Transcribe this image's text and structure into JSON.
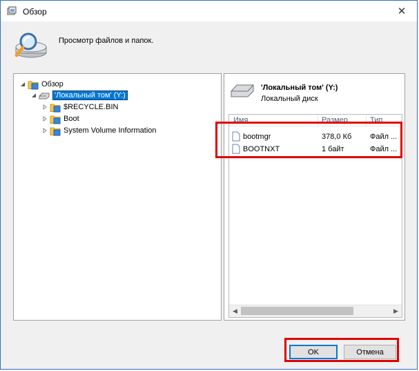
{
  "dialog": {
    "title": "Обзор",
    "description": "Просмотр файлов и папок.",
    "close_symbol": "✕"
  },
  "tree": {
    "root_label": "Обзор",
    "drive_label": "'Локальный том' (Y:)",
    "folders": [
      "$RECYCLE.BIN",
      "Boot",
      "System Volume Information"
    ]
  },
  "details": {
    "drive_title": "'Локальный том' (Y:)",
    "drive_subtitle": "Локальный диск",
    "columns": {
      "name": "Имя",
      "size": "Размер",
      "type": "Тип"
    },
    "rows": [
      {
        "name": "bootmgr",
        "size": "378,0 Кб",
        "type": "Файл ..."
      },
      {
        "name": "BOOTNXT",
        "size": "1 байт",
        "type": "Файл ..."
      }
    ]
  },
  "buttons": {
    "ok": "OK",
    "cancel": "Отмена"
  },
  "icons": {
    "folder": "folder-icon",
    "drive": "drive-icon",
    "file": "file-icon",
    "close": "close-icon",
    "browse": "browse-icon"
  },
  "colors": {
    "accent": "#0078d7",
    "highlight": "#e00000"
  }
}
